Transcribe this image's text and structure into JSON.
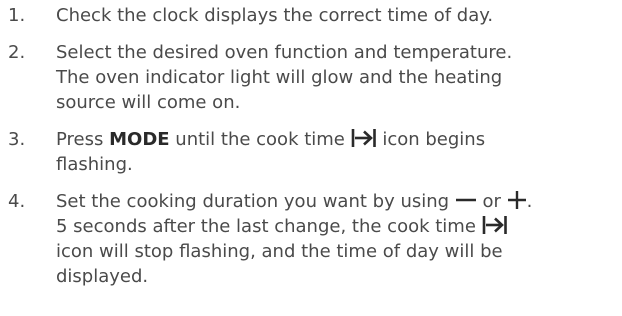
{
  "steps": [
    {
      "number": "1.",
      "text": "Check the clock displays the correct time of day."
    },
    {
      "number": "2.",
      "text_lines": [
        "Select the desired oven function and temperature.",
        "The oven indicator light will glow and the heating",
        "source will come on."
      ]
    },
    {
      "number": "3.",
      "pre": "Press ",
      "bold": "MODE",
      "mid": " until the cook time ",
      "icon": "cook-time-icon",
      "post": " icon begins",
      "line2": "flashing."
    },
    {
      "number": "4.",
      "l1_pre": "Set the cooking duration you want by using ",
      "minus_icon": "minus-icon",
      "l1_or": " or ",
      "plus_icon": "plus-icon",
      "l1_end": ".",
      "l2_pre": "5 seconds after the last change, the cook time ",
      "icon": "cook-time-icon",
      "l3": "icon will stop flashing, and the time of day will be",
      "l4": "displayed."
    }
  ]
}
